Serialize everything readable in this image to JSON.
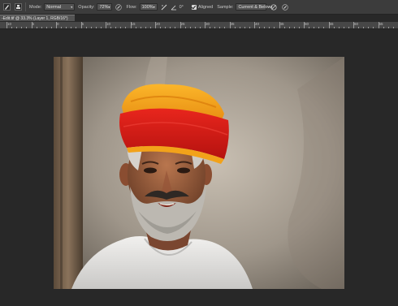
{
  "options": {
    "mode_label": "Mode:",
    "mode_value": "Normal",
    "opacity_label": "Opacity:",
    "opacity_value": "72%",
    "flow_label": "Flow:",
    "flow_value": "100%",
    "angle_value": "0°",
    "aligned_label": "Aligned",
    "sample_label": "Sample:",
    "sample_value": "Current & Below"
  },
  "tab": {
    "title": "-Edit.tif @ 33.3% (Layer 1, RGB/16*)"
  },
  "ruler": {
    "numbers": [
      "10",
      "5",
      "0",
      "5",
      "10",
      "15",
      "20",
      "25",
      "30",
      "35",
      "40",
      "45",
      "50",
      "55",
      "60",
      "65"
    ]
  },
  "photo": {
    "description_icon": "portrait-photo"
  },
  "colors": {
    "panel": "#3c3c3c",
    "workspace": "#282828",
    "turban_orange": "#f3a218",
    "turban_red": "#d8201c"
  }
}
